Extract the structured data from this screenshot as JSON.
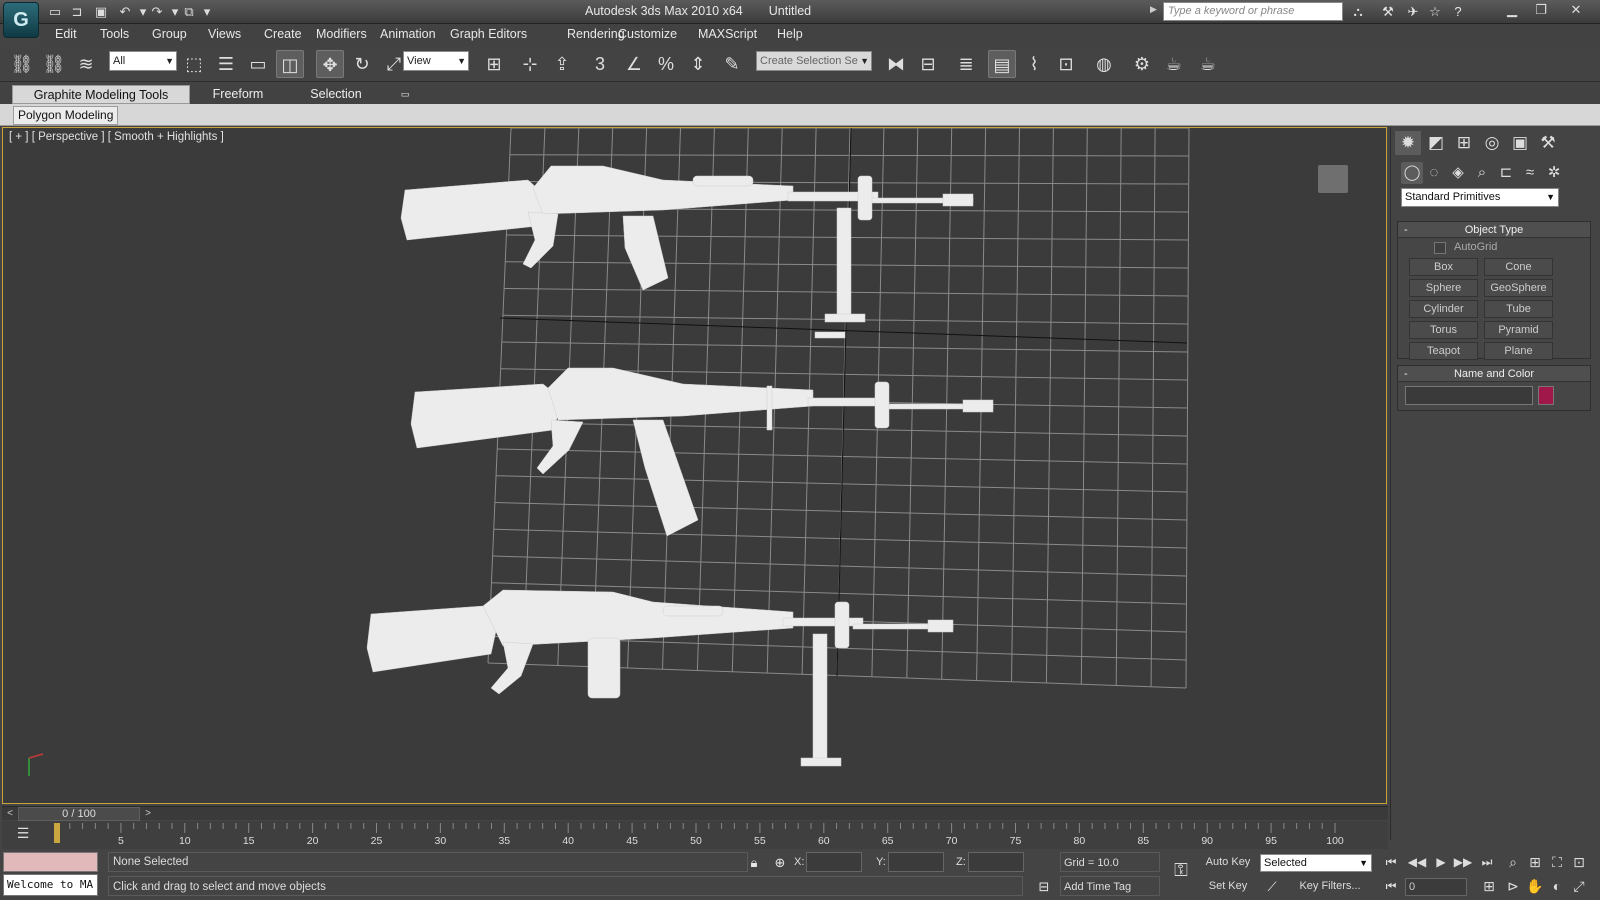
{
  "window": {
    "app_title": "Autodesk 3ds Max  2010 x64",
    "document_title": "Untitled",
    "search_placeholder": "Type a keyword or phrase",
    "logo_letter": "G"
  },
  "menu": [
    "Edit",
    "Tools",
    "Group",
    "Views",
    "Create",
    "Modifiers",
    "Animation",
    "Graph Editors",
    "Rendering",
    "Customize",
    "MAXScript",
    "Help"
  ],
  "toolbar": {
    "selection_filter": "All",
    "reference_coord": "View",
    "named_selection_placeholder": "Create Selection Se",
    "snap_label": "3"
  },
  "ribbon": {
    "tabs": [
      "Graphite Modeling Tools",
      "Freeform",
      "Selection"
    ],
    "panel_tab": "Polygon Modeling"
  },
  "viewport": {
    "label": "[ + ] [ Perspective ] [ Smooth + Highlights ]",
    "background": "#3b3b3b",
    "grid_color": "#8a8a8a",
    "model_color": "#eeeeee",
    "objects": [
      "rifle-model-1",
      "rifle-model-2",
      "rifle-model-3"
    ]
  },
  "command_panel": {
    "category": "Standard Primitives",
    "object_type_title": "Object Type",
    "autogrid_label": "AutoGrid",
    "primitives": [
      "Box",
      "Cone",
      "Sphere",
      "GeoSphere",
      "Cylinder",
      "Tube",
      "Torus",
      "Pyramid",
      "Teapot",
      "Plane"
    ],
    "name_color_title": "Name and Color",
    "object_color": "#a0174a"
  },
  "timeline": {
    "frame_readout": "0 / 100",
    "ruler_labels": [
      "5",
      "10",
      "15",
      "20",
      "25",
      "30",
      "35",
      "40",
      "45",
      "50",
      "55",
      "60",
      "65",
      "70",
      "75",
      "80",
      "85",
      "90",
      "95",
      "100"
    ],
    "current_frame": 0,
    "total_frames": 100
  },
  "status": {
    "maxscript_listener": "Welcome to MA",
    "selection": "None Selected",
    "prompt": "Click and drag to select and move objects",
    "x_label": "X:",
    "y_label": "Y:",
    "z_label": "Z:",
    "grid": "Grid = 10.0",
    "add_time_tag": "Add Time Tag",
    "auto_key": "Auto Key",
    "set_key": "Set Key",
    "key_mode": "Selected",
    "key_filters": "Key Filters...",
    "frame_value": "0"
  }
}
